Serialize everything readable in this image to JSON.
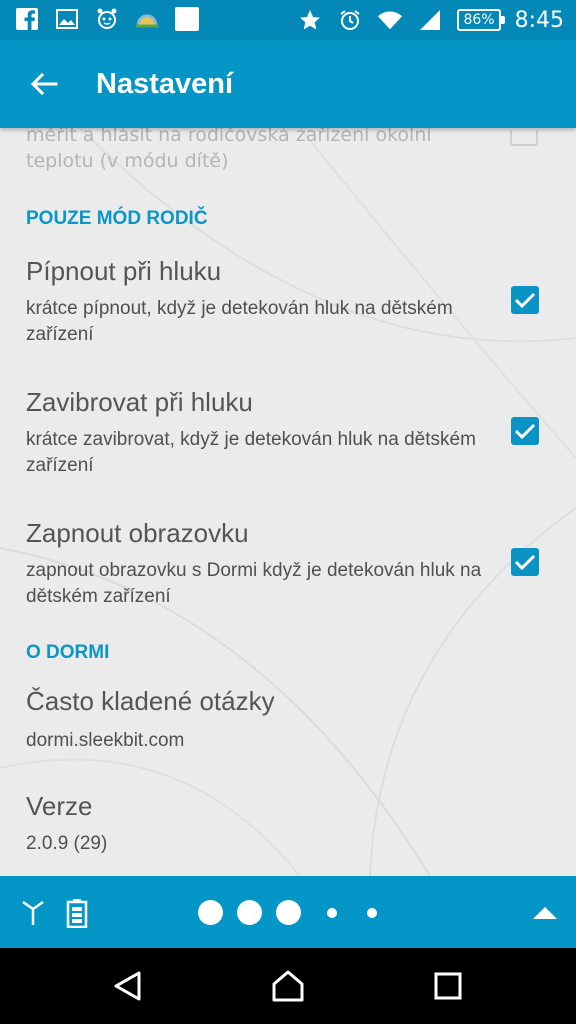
{
  "status_bar": {
    "time": "8:45",
    "battery": "86%",
    "left_icons": [
      "facebook-icon",
      "gallery-icon",
      "alarm-clock-app-icon",
      "weather-icon",
      "blank-notification-icon"
    ],
    "right_icons": [
      "star-icon",
      "alarm-icon",
      "wifi-icon",
      "signal-icon",
      "battery-icon"
    ]
  },
  "app_bar": {
    "title": "Nastavení",
    "back_icon": "arrow-back-icon"
  },
  "faded_item": {
    "summary": "měřit a hlásit na rodičovská zařízení okolní teplotu (v módu dítě)"
  },
  "sections": {
    "parent_only": "POUZE MÓD RODIČ",
    "about": "O DORMI"
  },
  "prefs": [
    {
      "title": "Pípnout při hluku",
      "summary": "krátce pípnout, když je detekován hluk na dětském zařízení",
      "checked": true
    },
    {
      "title": "Zavibrovat při hluku",
      "summary": "krátce zavibrovat, když je detekován hluk na dětském zařízení",
      "checked": true
    },
    {
      "title": "Zapnout obrazovku",
      "summary": "zapnout obrazovku s Dormi když je detekován hluk na dětském zařízení",
      "checked": true
    }
  ],
  "about": {
    "faq_title": "Často kladené otázky",
    "faq_summary": "dormi.sleekbit.com",
    "version_title": "Verze",
    "version_summary": "2.0.9 (29)"
  },
  "bottom_strip": {
    "left_icons": [
      "antenna-icon",
      "battery-status-icon"
    ],
    "page_dots": 5,
    "right_icon": "expand-up-icon"
  },
  "colors": {
    "primary": "#0496c7",
    "status_bar": "#0388b8",
    "accent": "#0a94c5",
    "background": "#ebebeb"
  }
}
